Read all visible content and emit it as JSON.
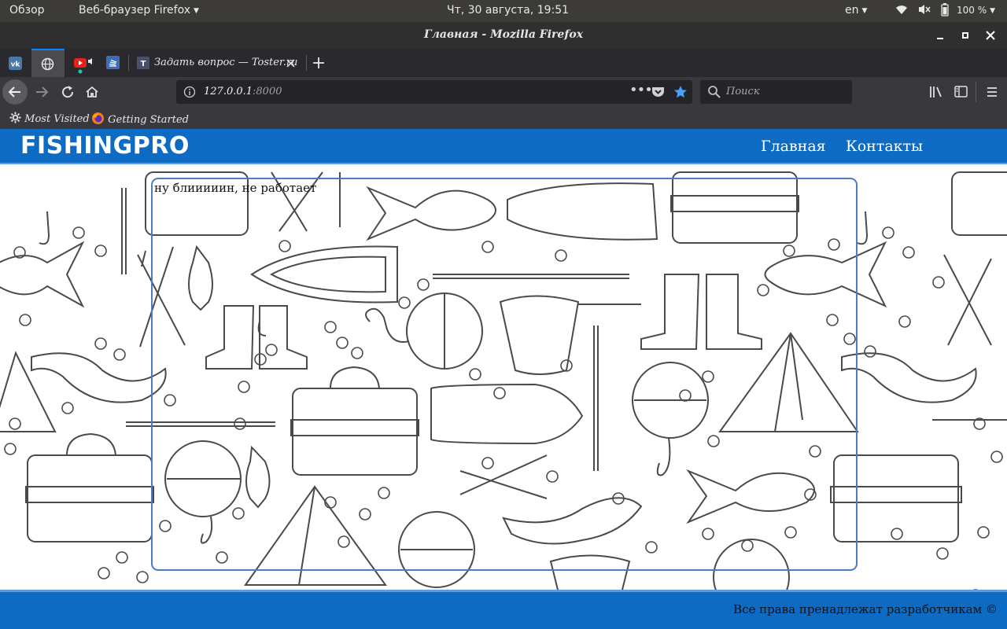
{
  "os_panel": {
    "activities": "Обзор",
    "app_menu": "Веб-браузер Firefox",
    "clock": "Чт, 30 августа, 19:51",
    "language": "en",
    "battery": "100 %"
  },
  "window": {
    "title": "Главная - Mozilla Firefox"
  },
  "tabs": [
    {
      "label": "",
      "icon": "vk-icon"
    },
    {
      "label": "",
      "icon": "globe-icon"
    },
    {
      "label": "",
      "icon": "youtube-icon"
    },
    {
      "label": "",
      "icon": "stackoverflow-icon"
    },
    {
      "label": "Задать вопрос — Toster.ru",
      "icon": "toster-icon"
    }
  ],
  "urlbar": {
    "host": "127.0.0.1",
    "port": ":8000"
  },
  "search": {
    "placeholder": "Поиск"
  },
  "bookmarks": [
    {
      "label": "Most Visited",
      "icon": "gear-icon"
    },
    {
      "label": "Getting Started",
      "icon": "firefox-icon"
    }
  ],
  "site": {
    "logo": "FISHINGPRO",
    "nav": [
      "Главная",
      "Контакты"
    ],
    "card_text": "ну блииииин, не работает",
    "footer": "Все права пренадлежат разработчикам ©"
  },
  "colors": {
    "accent": "#0d6bc4",
    "card_border": "#4d7cc7",
    "browser_dark": "#2a2a2e"
  }
}
